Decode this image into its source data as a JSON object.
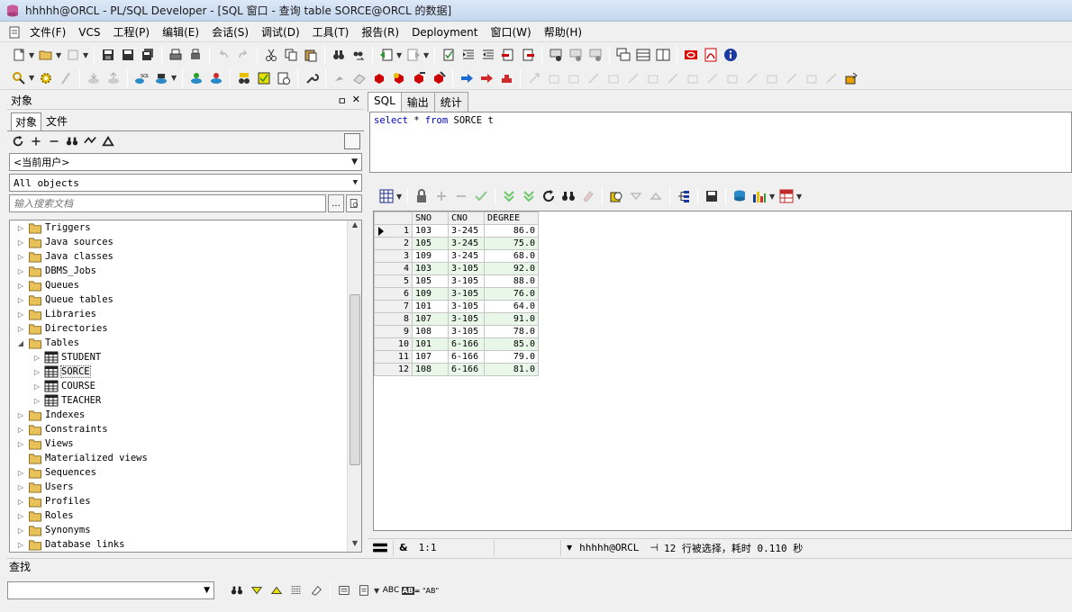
{
  "window": {
    "title": "hhhhh@ORCL - PL/SQL Developer - [SQL 窗口 - 查询 table SORCE@ORCL 的数据]"
  },
  "menu": [
    "文件(F)",
    "VCS",
    "工程(P)",
    "编辑(E)",
    "会话(S)",
    "调试(D)",
    "工具(T)",
    "报告(R)",
    "Deployment",
    "窗口(W)",
    "帮助(H)"
  ],
  "left_panel": {
    "title": "对象",
    "pin": "ㅁ",
    "close": "✕",
    "tabs": [
      "对象",
      "文件"
    ],
    "user_filter": "<当前用户>",
    "object_filter": "All objects",
    "search_placeholder": "输入搜索文档",
    "search_btn": "...",
    "tree": [
      {
        "label": "Triggers",
        "type": "folder",
        "level": 0,
        "expanded": false
      },
      {
        "label": "Java sources",
        "type": "folder",
        "level": 0,
        "expanded": false
      },
      {
        "label": "Java classes",
        "type": "folder",
        "level": 0,
        "expanded": false
      },
      {
        "label": "DBMS_Jobs",
        "type": "folder",
        "level": 0,
        "expanded": false
      },
      {
        "label": "Queues",
        "type": "folder",
        "level": 0,
        "expanded": false
      },
      {
        "label": "Queue tables",
        "type": "folder",
        "level": 0,
        "expanded": false
      },
      {
        "label": "Libraries",
        "type": "folder",
        "level": 0,
        "expanded": false
      },
      {
        "label": "Directories",
        "type": "folder",
        "level": 0,
        "expanded": false
      },
      {
        "label": "Tables",
        "type": "folder",
        "level": 0,
        "expanded": true
      },
      {
        "label": "STUDENT",
        "type": "table",
        "level": 1,
        "expanded": false
      },
      {
        "label": "SORCE",
        "type": "table",
        "level": 1,
        "expanded": false,
        "selected": true
      },
      {
        "label": "COURSE",
        "type": "table",
        "level": 1,
        "expanded": false
      },
      {
        "label": "TEACHER",
        "type": "table",
        "level": 1,
        "expanded": false
      },
      {
        "label": "Indexes",
        "type": "folder",
        "level": 0,
        "expanded": false
      },
      {
        "label": "Constraints",
        "type": "folder",
        "level": 0,
        "expanded": false
      },
      {
        "label": "Views",
        "type": "folder",
        "level": 0,
        "expanded": false
      },
      {
        "label": "Materialized views",
        "type": "folder",
        "level": 0,
        "expanded": false,
        "leaf": true
      },
      {
        "label": "Sequences",
        "type": "folder",
        "level": 0,
        "expanded": false
      },
      {
        "label": "Users",
        "type": "folder",
        "level": 0,
        "expanded": false
      },
      {
        "label": "Profiles",
        "type": "folder",
        "level": 0,
        "expanded": false
      },
      {
        "label": "Roles",
        "type": "folder",
        "level": 0,
        "expanded": false
      },
      {
        "label": "Synonyms",
        "type": "folder",
        "level": 0,
        "expanded": false
      },
      {
        "label": "Database links",
        "type": "folder",
        "level": 0,
        "expanded": false
      }
    ]
  },
  "editor": {
    "tabs": [
      "SQL",
      "输出",
      "统计"
    ],
    "active_tab": 0,
    "sql": {
      "kw1": "select",
      "star": " * ",
      "kw2": "from",
      "rest": " SORCE t"
    }
  },
  "grid": {
    "columns": [
      "SNO",
      "CNO",
      "DEGREE"
    ],
    "rows": [
      [
        "1",
        "103",
        "3-245",
        "86.0"
      ],
      [
        "2",
        "105",
        "3-245",
        "75.0"
      ],
      [
        "3",
        "109",
        "3-245",
        "68.0"
      ],
      [
        "4",
        "103",
        "3-105",
        "92.0"
      ],
      [
        "5",
        "105",
        "3-105",
        "88.0"
      ],
      [
        "6",
        "109",
        "3-105",
        "76.0"
      ],
      [
        "7",
        "101",
        "3-105",
        "64.0"
      ],
      [
        "8",
        "107",
        "3-105",
        "91.0"
      ],
      [
        "9",
        "108",
        "3-105",
        "78.0"
      ],
      [
        "10",
        "101",
        "6-166",
        "85.0"
      ],
      [
        "11",
        "107",
        "6-166",
        "79.0"
      ],
      [
        "12",
        "108",
        "6-166",
        "81.0"
      ]
    ]
  },
  "status": {
    "position": "1:1",
    "connection": "hhhhh@ORCL",
    "message": "12 行被选择，耗时 0.110 秒"
  },
  "find": {
    "title": "查找"
  },
  "colors": {
    "keyword": "#0000c0",
    "row_alt": "#e8f7e8",
    "folder": "#e8c15a"
  }
}
